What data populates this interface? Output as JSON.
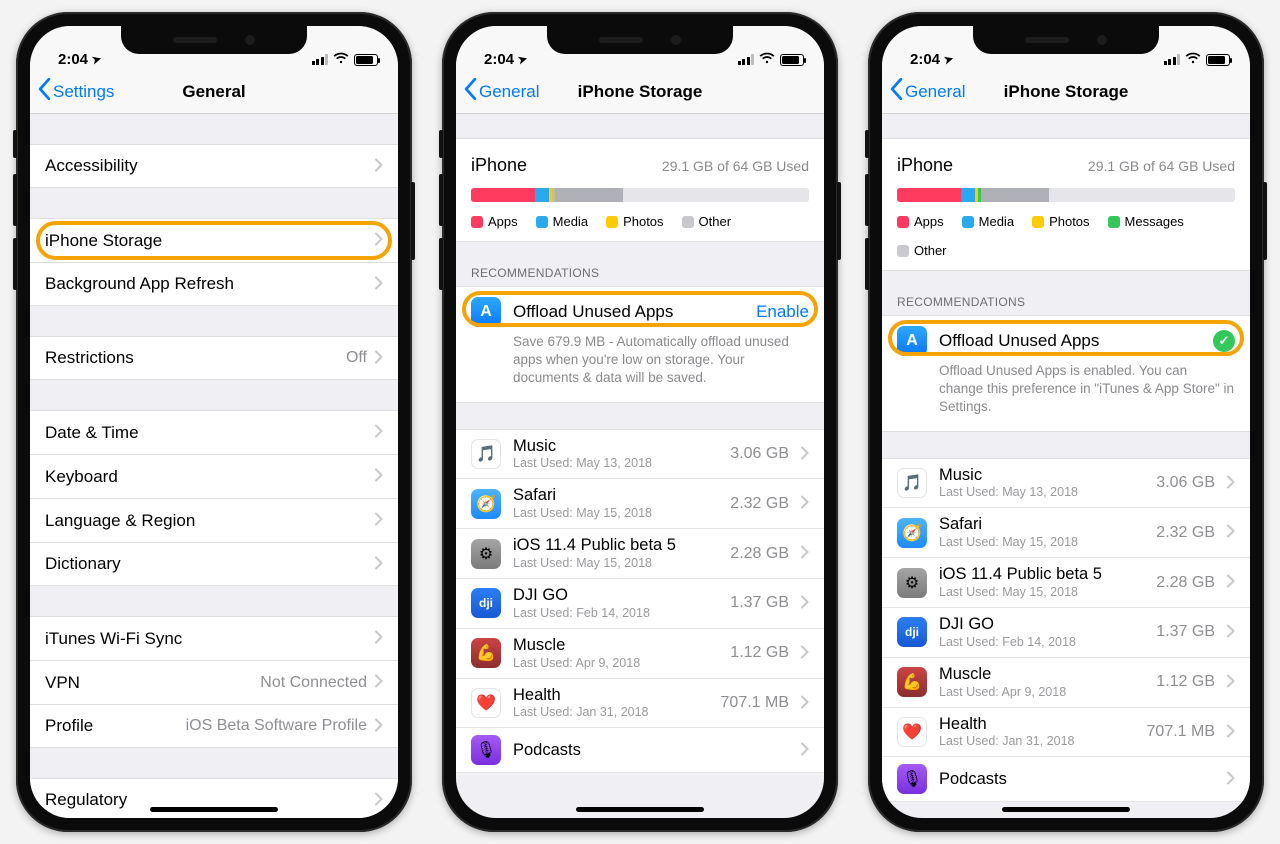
{
  "status": {
    "time": "2:04"
  },
  "screens": [
    {
      "nav": {
        "back": "Settings",
        "title": "General"
      },
      "groups": [
        {
          "cells": [
            {
              "label": "Accessibility"
            }
          ]
        },
        {
          "cells": [
            {
              "label": "iPhone Storage",
              "highlight": true
            },
            {
              "label": "Background App Refresh"
            }
          ]
        },
        {
          "cells": [
            {
              "label": "Restrictions",
              "value": "Off"
            }
          ]
        },
        {
          "cells": [
            {
              "label": "Date & Time"
            },
            {
              "label": "Keyboard"
            },
            {
              "label": "Language & Region"
            },
            {
              "label": "Dictionary"
            }
          ]
        },
        {
          "cells": [
            {
              "label": "iTunes Wi-Fi Sync"
            },
            {
              "label": "VPN",
              "value": "Not Connected"
            },
            {
              "label": "Profile",
              "value": "iOS Beta Software Profile"
            }
          ]
        },
        {
          "cells": [
            {
              "label": "Regulatory"
            }
          ]
        }
      ]
    },
    {
      "nav": {
        "back": "General",
        "title": "iPhone Storage"
      },
      "storage": {
        "device": "iPhone",
        "used": "29.1 GB of 64 GB Used",
        "segments": [
          {
            "color": "#ff3b60",
            "pct": 19
          },
          {
            "color": "#2aa9ee",
            "pct": 4
          },
          {
            "color": "#ffcb05",
            "pct": 1
          },
          {
            "color": "#cfbd88",
            "pct": 1
          },
          {
            "color": "#b0b0b8",
            "pct": 20
          }
        ],
        "legend": [
          {
            "color": "#ff3b60",
            "label": "Apps"
          },
          {
            "color": "#2aa9ee",
            "label": "Media"
          },
          {
            "color": "#ffcb05",
            "label": "Photos"
          },
          {
            "color": "#c8c8ce",
            "label": "Other"
          }
        ]
      },
      "recHeader": "RECOMMENDATIONS",
      "recommendation": {
        "title": "Offload Unused Apps",
        "action": "Enable",
        "sub": "Save 679.9 MB - Automatically offload unused apps when you're low on storage. Your documents & data will be saved."
      },
      "apps": [
        {
          "name": "Music",
          "sub": "Last Used: May 13, 2018",
          "size": "3.06 GB",
          "glyph": "🎵",
          "cls": ""
        },
        {
          "name": "Safari",
          "sub": "Last Used: May 15, 2018",
          "size": "2.32 GB",
          "glyph": "🧭",
          "cls": "safari"
        },
        {
          "name": "iOS 11.4 Public beta 5",
          "sub": "Last Used: May 15, 2018",
          "size": "2.28 GB",
          "glyph": "⚙︎",
          "cls": "settings"
        },
        {
          "name": "DJI GO",
          "sub": "Last Used: Feb 14, 2018",
          "size": "1.37 GB",
          "glyph": "dji",
          "cls": "dji"
        },
        {
          "name": "Muscle",
          "sub": "Last Used: Apr 9, 2018",
          "size": "1.12 GB",
          "glyph": "💪",
          "cls": "muscle"
        },
        {
          "name": "Health",
          "sub": "Last Used: Jan 31, 2018",
          "size": "707.1 MB",
          "glyph": "❤️",
          "cls": ""
        },
        {
          "name": "Podcasts",
          "sub": "",
          "size": "",
          "glyph": "🎙",
          "cls": "pod"
        }
      ]
    },
    {
      "nav": {
        "back": "General",
        "title": "iPhone Storage"
      },
      "storage": {
        "device": "iPhone",
        "used": "29.1 GB of 64 GB Used",
        "segments": [
          {
            "color": "#ff3b60",
            "pct": 19
          },
          {
            "color": "#2aa9ee",
            "pct": 4
          },
          {
            "color": "#ffcb05",
            "pct": 1
          },
          {
            "color": "#34c759",
            "pct": 1
          },
          {
            "color": "#b0b0b8",
            "pct": 20
          }
        ],
        "legend": [
          {
            "color": "#ff3b60",
            "label": "Apps"
          },
          {
            "color": "#2aa9ee",
            "label": "Media"
          },
          {
            "color": "#ffcb05",
            "label": "Photos"
          },
          {
            "color": "#34c759",
            "label": "Messages"
          },
          {
            "color": "#c8c8ce",
            "label": "Other"
          }
        ]
      },
      "recHeader": "RECOMMENDATIONS",
      "recommendation": {
        "title": "Offload Unused Apps",
        "done": true,
        "sub": "Offload Unused Apps is enabled. You can change this preference in \"iTunes & App Store\" in Settings."
      },
      "apps": [
        {
          "name": "Music",
          "sub": "Last Used: May 13, 2018",
          "size": "3.06 GB",
          "glyph": "🎵",
          "cls": ""
        },
        {
          "name": "Safari",
          "sub": "Last Used: May 15, 2018",
          "size": "2.32 GB",
          "glyph": "🧭",
          "cls": "safari"
        },
        {
          "name": "iOS 11.4 Public beta 5",
          "sub": "Last Used: May 15, 2018",
          "size": "2.28 GB",
          "glyph": "⚙︎",
          "cls": "settings"
        },
        {
          "name": "DJI GO",
          "sub": "Last Used: Feb 14, 2018",
          "size": "1.37 GB",
          "glyph": "dji",
          "cls": "dji"
        },
        {
          "name": "Muscle",
          "sub": "Last Used: Apr 9, 2018",
          "size": "1.12 GB",
          "glyph": "💪",
          "cls": "muscle"
        },
        {
          "name": "Health",
          "sub": "Last Used: Jan 31, 2018",
          "size": "707.1 MB",
          "glyph": "❤️",
          "cls": ""
        },
        {
          "name": "Podcasts",
          "sub": "",
          "size": "",
          "glyph": "🎙",
          "cls": "pod"
        }
      ]
    }
  ]
}
